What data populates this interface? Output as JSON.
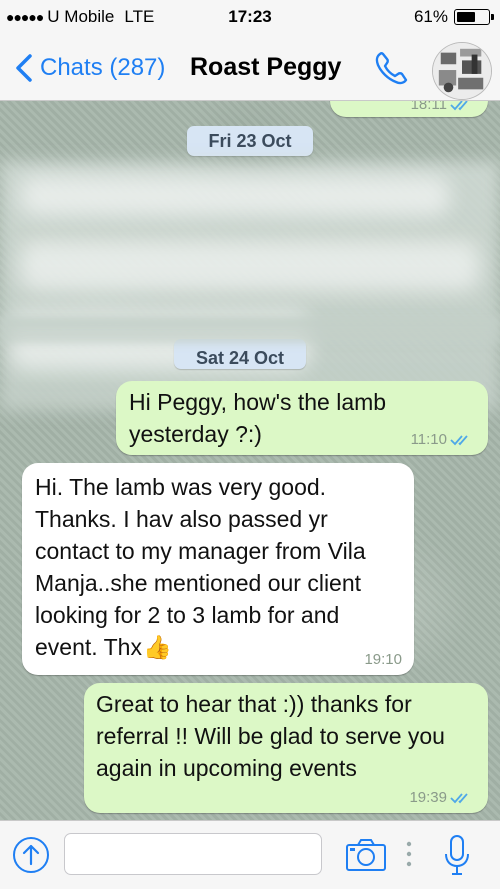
{
  "status_bar": {
    "signal": "●●●●●",
    "carrier": "U Mobile",
    "network": "LTE",
    "time": "17:23",
    "battery": "61%",
    "battery_level": 0.61
  },
  "nav": {
    "back_label": "Chats (287)",
    "title": "Roast Peggy",
    "accent": "#1f7ff3"
  },
  "chat": {
    "top_partial_time": "18:11",
    "date_1": "Fri 23 Oct",
    "date_2": "Sat 24 Oct",
    "messages": [
      {
        "text": "Hi Peggy, how's the lamb yesterday ?:)",
        "time": "11:10"
      },
      {
        "text": "Hi. The lamb was very good. Thanks. I hav also passed yr contact to my manager from Vila Manja..she mentioned our client looking for 2 to 3 lamb for and event. Thx",
        "emoji": "👍",
        "time": "19:10"
      },
      {
        "text": "Great to hear that :)) thanks for referral !! Will be glad to serve you again in upcoming events",
        "time": "19:39"
      }
    ]
  },
  "input": {
    "placeholder": ""
  },
  "colors": {
    "outgoing_bubble": "#dcf8c6",
    "incoming_bubble": "#ffffff",
    "read_ticks": "#4fa8e8"
  }
}
